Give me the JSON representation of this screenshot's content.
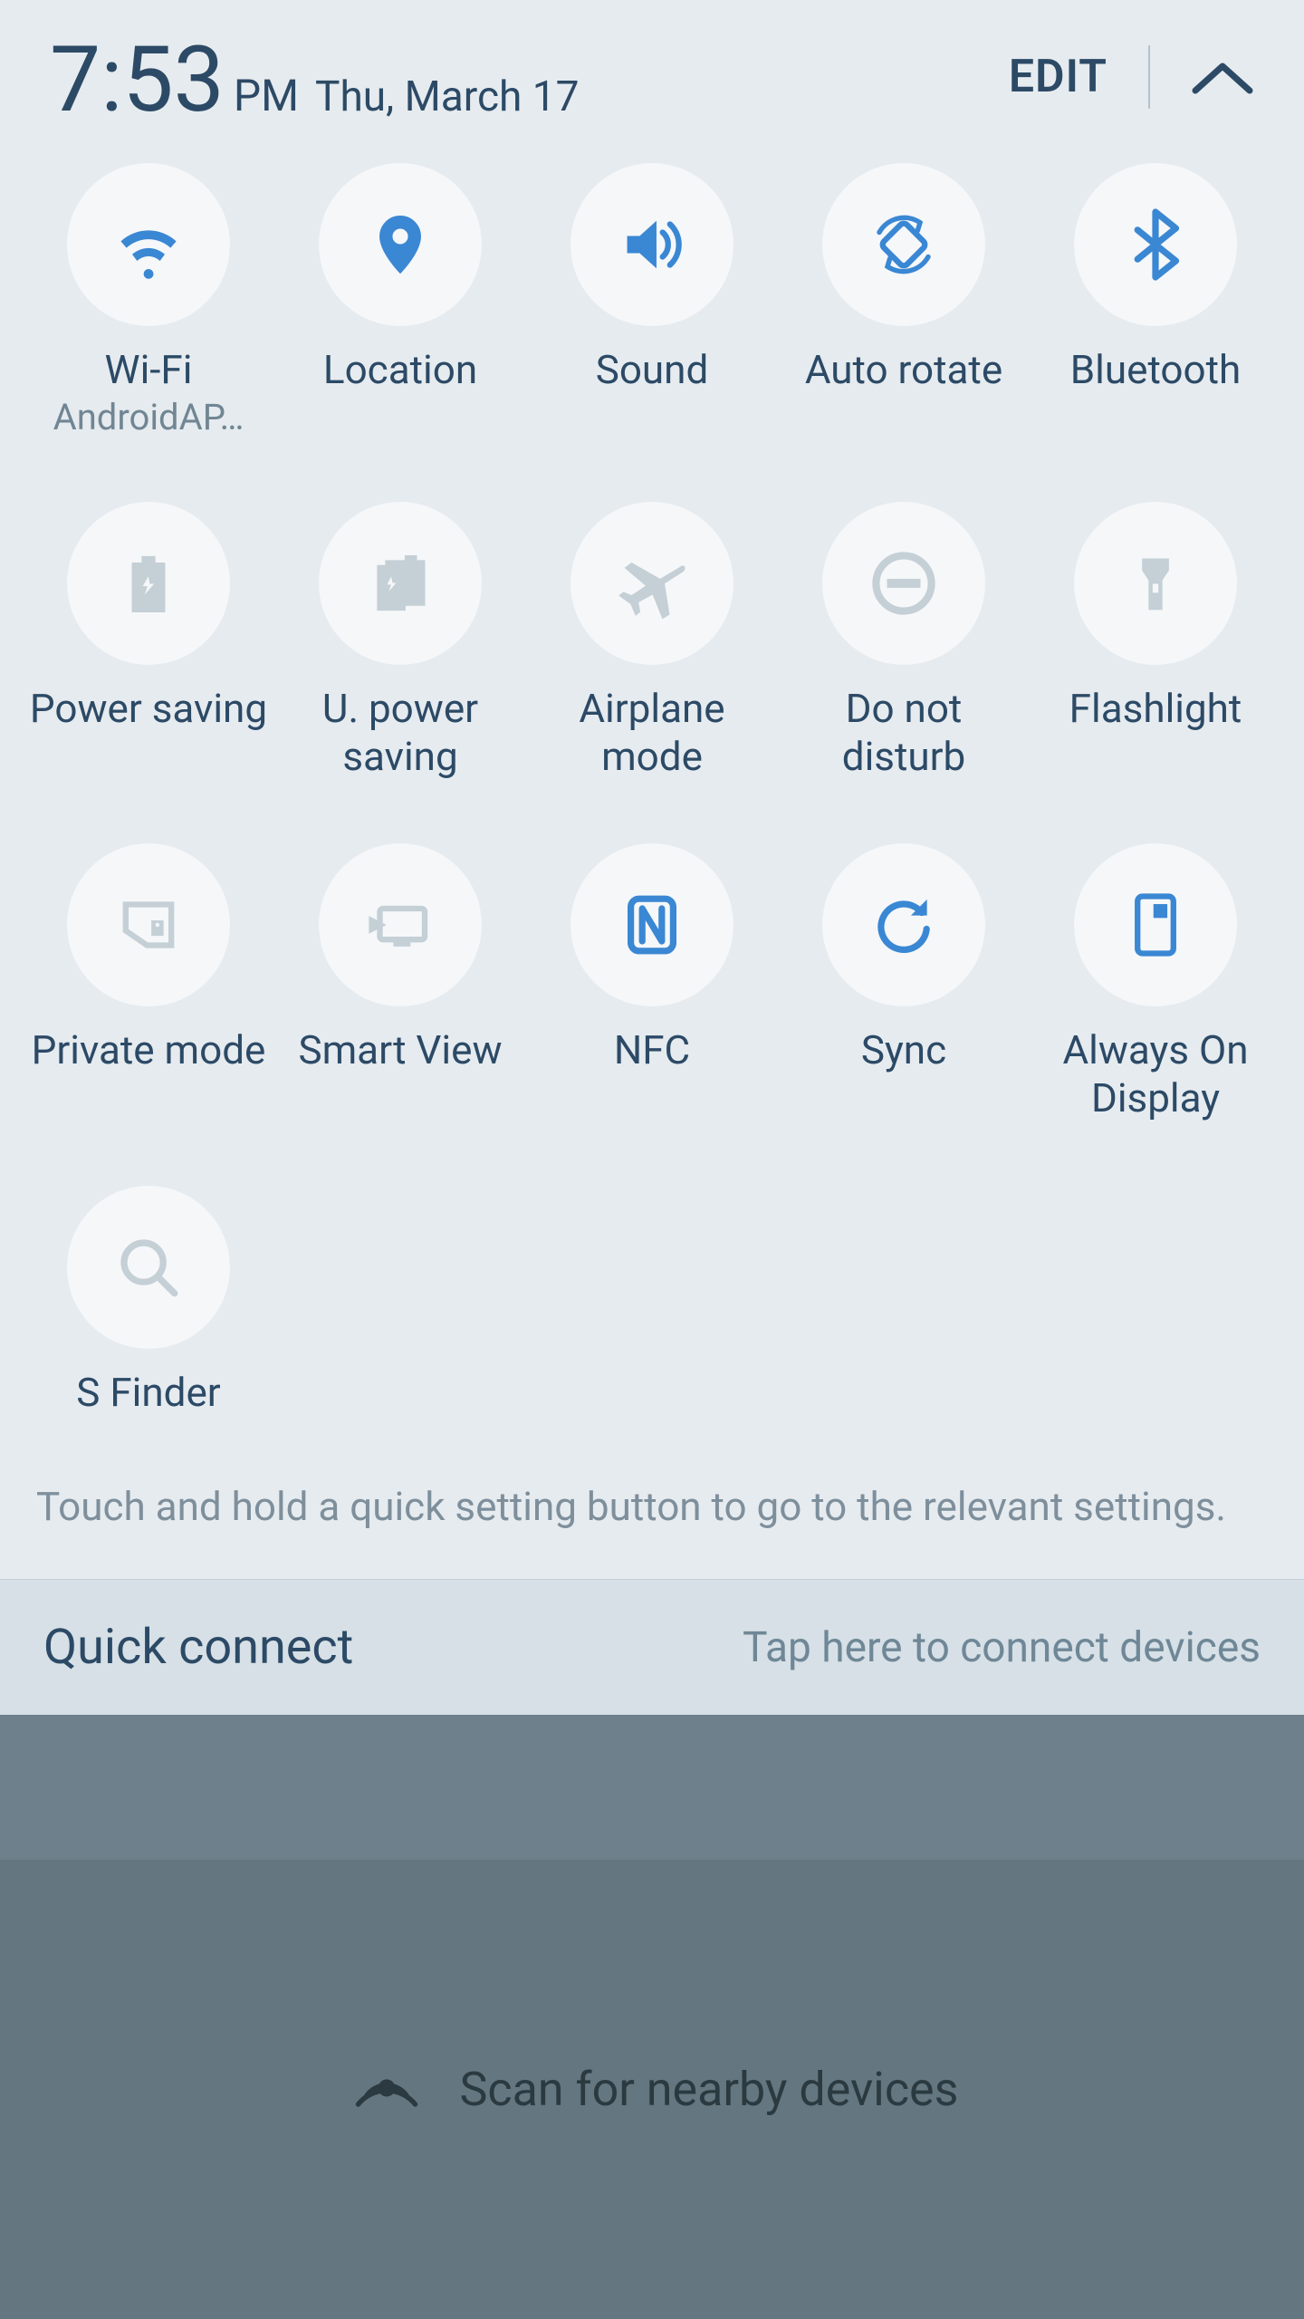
{
  "header": {
    "time": "7:53",
    "ampm": "PM",
    "date": "Thu, March 17",
    "edit": "EDIT"
  },
  "tiles": [
    {
      "id": "wifi",
      "label": "Wi-Fi",
      "sublabel": "AndroidAP…",
      "active": true
    },
    {
      "id": "location",
      "label": "Location",
      "sublabel": "",
      "active": true
    },
    {
      "id": "sound",
      "label": "Sound",
      "sublabel": "",
      "active": true
    },
    {
      "id": "auto-rotate",
      "label": "Auto rotate",
      "sublabel": "",
      "active": true
    },
    {
      "id": "bluetooth",
      "label": "Bluetooth",
      "sublabel": "",
      "active": true
    },
    {
      "id": "power-saving",
      "label": "Power saving",
      "sublabel": "",
      "active": false
    },
    {
      "id": "u-power-saving",
      "label": "U. power saving",
      "sublabel": "",
      "active": false
    },
    {
      "id": "airplane-mode",
      "label": "Airplane mode",
      "sublabel": "",
      "active": false
    },
    {
      "id": "do-not-disturb",
      "label": "Do not disturb",
      "sublabel": "",
      "active": false
    },
    {
      "id": "flashlight",
      "label": "Flashlight",
      "sublabel": "",
      "active": false
    },
    {
      "id": "private-mode",
      "label": "Private mode",
      "sublabel": "",
      "active": false
    },
    {
      "id": "smart-view",
      "label": "Smart View",
      "sublabel": "",
      "active": false
    },
    {
      "id": "nfc",
      "label": "NFC",
      "sublabel": "",
      "active": true
    },
    {
      "id": "sync",
      "label": "Sync",
      "sublabel": "",
      "active": true
    },
    {
      "id": "always-on-display",
      "label": "Always On Display",
      "sublabel": "",
      "active": true
    },
    {
      "id": "s-finder",
      "label": "S Finder",
      "sublabel": "",
      "active": false
    }
  ],
  "hint": "Touch and hold a quick setting button to go to the relevant settings.",
  "quick_connect": {
    "title": "Quick connect",
    "hint": "Tap here to connect devices"
  },
  "scan": {
    "label": "Scan for nearby devices"
  }
}
